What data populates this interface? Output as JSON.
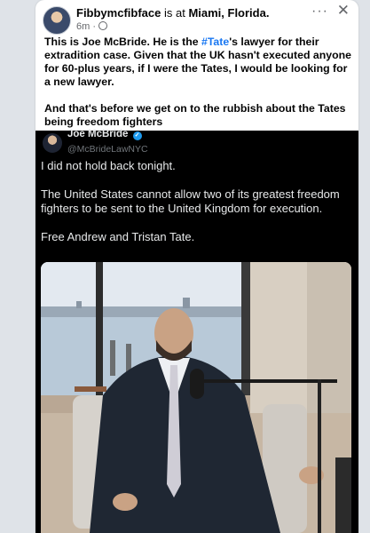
{
  "post": {
    "author": "Fibbymcfibface",
    "connector": " is at ",
    "location": "Miami, Florida.",
    "time": "6m",
    "dot": " · ",
    "more_icon": "more-horizontal-icon",
    "close_icon": "close-icon",
    "text_part1": "This is Joe McBride. He is the ",
    "hashtag": "#Tate",
    "text_part2": "'s lawyer for their extradition case. Given that the UK hasn't executed anyone for 60-plus years, if I were the Tates, I would be looking for a new lawyer.",
    "text_para2": "And that's before we get on to the rubbish about the Tates being freedom fighters"
  },
  "embedded_tweet": {
    "name": "Joe McBride",
    "verified_icon": "verified-badge-icon",
    "handle": "@McBrideLawNYC",
    "paragraphs": [
      "I did not hold back tonight.",
      "The United States cannot allow two of its greatest freedom fighters to be sent to the United Kingdom for execution.",
      "Free Andrew and Tristan Tate."
    ]
  },
  "colors": {
    "link": "#1877f2",
    "tweet_bg": "#000000",
    "verified": "#1d9bf0"
  }
}
